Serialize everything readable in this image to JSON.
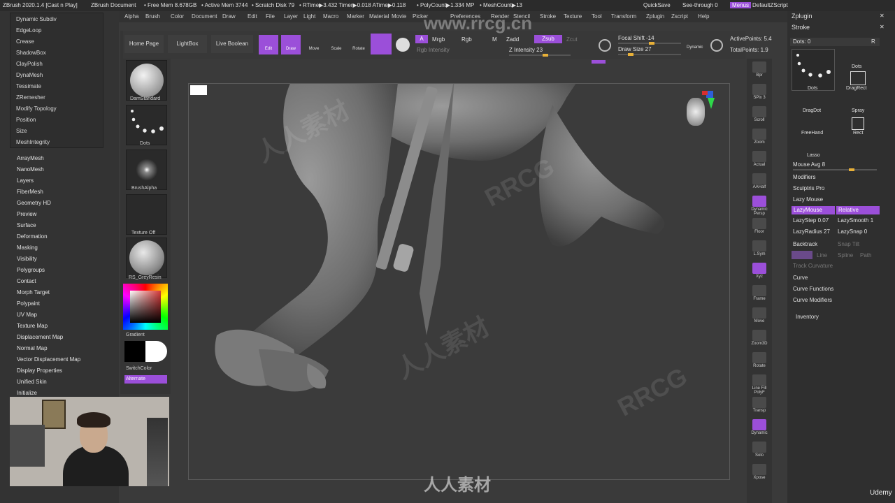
{
  "status_bar": {
    "app": "ZBrush 2020.1.4 [Cast n Play]",
    "document": "ZBrush Document",
    "free_mem": "• Free Mem 8.678GB",
    "active_mem": "• Active Mem 3744",
    "scratch": "• Scratch Disk 79",
    "rtime": "• RTime▶3.432 Timer▶0.018 ATime▶0.118",
    "polycount": "• PolyCount▶1.334 MP",
    "meshcount": "• MeshCount▶13",
    "quicksave": "QuickSave",
    "see_through": "See-through  0",
    "menus": "Menus",
    "default_zscript": "DefaultZScript"
  },
  "menu_bar": [
    "Alpha",
    "Brush",
    "Color",
    "Document",
    "Draw",
    "Edit",
    "File",
    "Layer",
    "Light",
    "Macro",
    "Marker",
    "Material",
    "Movie",
    "Picker",
    "Preferences",
    "Render",
    "Stencil",
    "Stroke",
    "Texture",
    "Tool",
    "Transform",
    "Zplugin",
    "Zscript",
    "Help"
  ],
  "subpalette_items": [
    "Dynamic Subdiv",
    "EdgeLoop",
    "Crease",
    "ShadowBox",
    "ClayPolish",
    "DynaMesh",
    "Tessimate",
    "ZRemesher",
    "Modify Topology",
    "Position",
    "Size",
    "MeshIntegrity"
  ],
  "tool_items": [
    "ArrayMesh",
    "NanoMesh",
    "Layers",
    "FiberMesh",
    "Geometry HD",
    "Preview",
    "Surface",
    "Deformation",
    "Masking",
    "Visibility",
    "Polygroups",
    "Contact",
    "Morph Target",
    "Polypaint",
    "UV Map",
    "Texture Map",
    "Displacement Map",
    "Normal Map",
    "Vector Displacement Map",
    "Display Properties",
    "Unified Skin",
    "Initialize"
  ],
  "shelf": {
    "brush": "DamStandard",
    "stroke": "Dots",
    "alpha": "BrushAlpha",
    "texture": "Texture Off",
    "material": "RS_GreyResin",
    "gradient": "Gradient",
    "switch_color": "SwitchColor",
    "alternate": "Alternate"
  },
  "top_shelf": {
    "home": "Home Page",
    "lightbox": "LightBox",
    "live_boolean": "Live Boolean",
    "edit": "Edit",
    "draw": "Draw",
    "move": "Move",
    "scale": "Scale",
    "rotate": "Rotate",
    "a": "A",
    "mrgb": "Mrgb",
    "rgb": "Rgb",
    "m": "M",
    "zadd": "Zadd",
    "zsub": "Zsub",
    "zcut": "Zcut",
    "rgb_intensity": "Rgb Intensity",
    "z_intensity": "Z Intensity 23",
    "focal_shift": "Focal Shift -14",
    "draw_size": "Draw Size 27",
    "dynamic": "Dynamic",
    "active_points": "ActivePoints: 5.4",
    "total_points": "TotalPoints: 1.9"
  },
  "right_tools": [
    "Bpr",
    "SPix 3",
    "Scroll",
    "Zoom",
    "Actual",
    "AAHalf",
    "Dynamic Persp",
    "Floor",
    "L.Sym",
    "Xyz",
    "Frame",
    "Move",
    "Zoom3D",
    "Rotate",
    "Line Fill PolyF",
    "Transp",
    "Dynamic",
    "Solo",
    "Xpose"
  ],
  "right_panel": {
    "zplugin": "Zplugin",
    "stroke": "Stroke",
    "dots": "Dots: 0",
    "r": "R",
    "strokes": [
      "Dots",
      "Dots",
      "DragRect",
      "DragDot",
      "Spray",
      "FreeHand",
      "Rect",
      "Lasso"
    ],
    "mouse_avg": "Mouse Avg 8",
    "modifiers": "Modifiers",
    "sculptris_pro": "Sculptris Pro",
    "lazy_mouse": "Lazy Mouse",
    "lazymouse_btn": "LazyMouse",
    "relative_btn": "Relative",
    "lazystep": "LazyStep 0.07",
    "lazysmooth": "LazySmooth 1",
    "lazyradius": "LazyRadius 27",
    "lazysnap": "LazySnap 0",
    "backtrack": "Backtrack",
    "snap_tilt": "Snap Tilt",
    "line": "Line",
    "spline": "Spline",
    "path": "Path",
    "track_curvature": "Track Curvature",
    "curve": "Curve",
    "curve_functions": "Curve Functions",
    "curve_modifiers": "Curve Modifiers",
    "inventory": "Inventory"
  },
  "watermark": {
    "site": "www.rrcg.cn",
    "cn": "人人素材",
    "rrcg": "RRCG",
    "udemy": "Udemy"
  },
  "colors": {
    "accent": "#9b4fd9",
    "slider": "#e8b038",
    "bg": "#3a3a3a"
  }
}
